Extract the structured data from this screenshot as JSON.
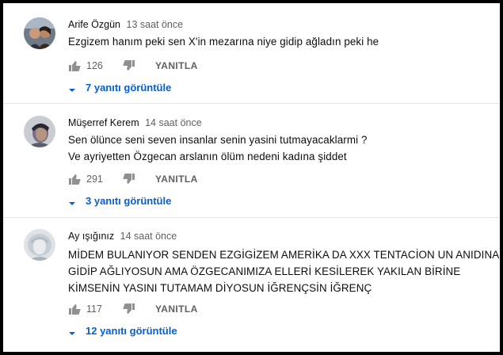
{
  "comments": [
    {
      "author": "Arife Özgün",
      "time": "13 saat önce",
      "lines": [
        "Ezgizem hanım peki sen X'in mezarına niye gidip ağladın peki he"
      ],
      "likes": "126",
      "reply_label": "YANITLA",
      "replies_label": "7 yanıtı görüntüle"
    },
    {
      "author": "Müşerref Kerem",
      "time": "14 saat önce",
      "lines": [
        "Sen ölünce seni seven insanlar senin yasini tutmayacaklarmi ?",
        "Ve ayriyetten Özgecan arslanın ölüm nedeni kadına şiddet"
      ],
      "likes": "291",
      "reply_label": "YANITLA",
      "replies_label": "3 yanıtı görüntüle"
    },
    {
      "author": "Ay ışığınız",
      "time": "14 saat önce",
      "lines": [
        "MİDEM BULANIYOR SENDEN EZGİGİZEM AMERİKA DA XXX TENTACİON UN ANIDINA",
        "GİDİP AĞLIYOSUN AMA ÖZGECANIMIZA ELLERİ KESİLEREK YAKILAN BİRİNE",
        "KİMSENİN YASINI TUTAMAM DİYOSUN İĞRENÇSİN İĞRENÇ"
      ],
      "likes": "117",
      "reply_label": "YANITLA",
      "replies_label": "12 yanıtı görüntüle"
    }
  ],
  "icons": {
    "like": "thumb-up-icon",
    "dislike": "thumb-down-icon",
    "caret": "caret-down-icon"
  },
  "colors": {
    "link": "#065fd4",
    "secondary_text": "#606060",
    "primary_text": "#0d0d0d"
  }
}
